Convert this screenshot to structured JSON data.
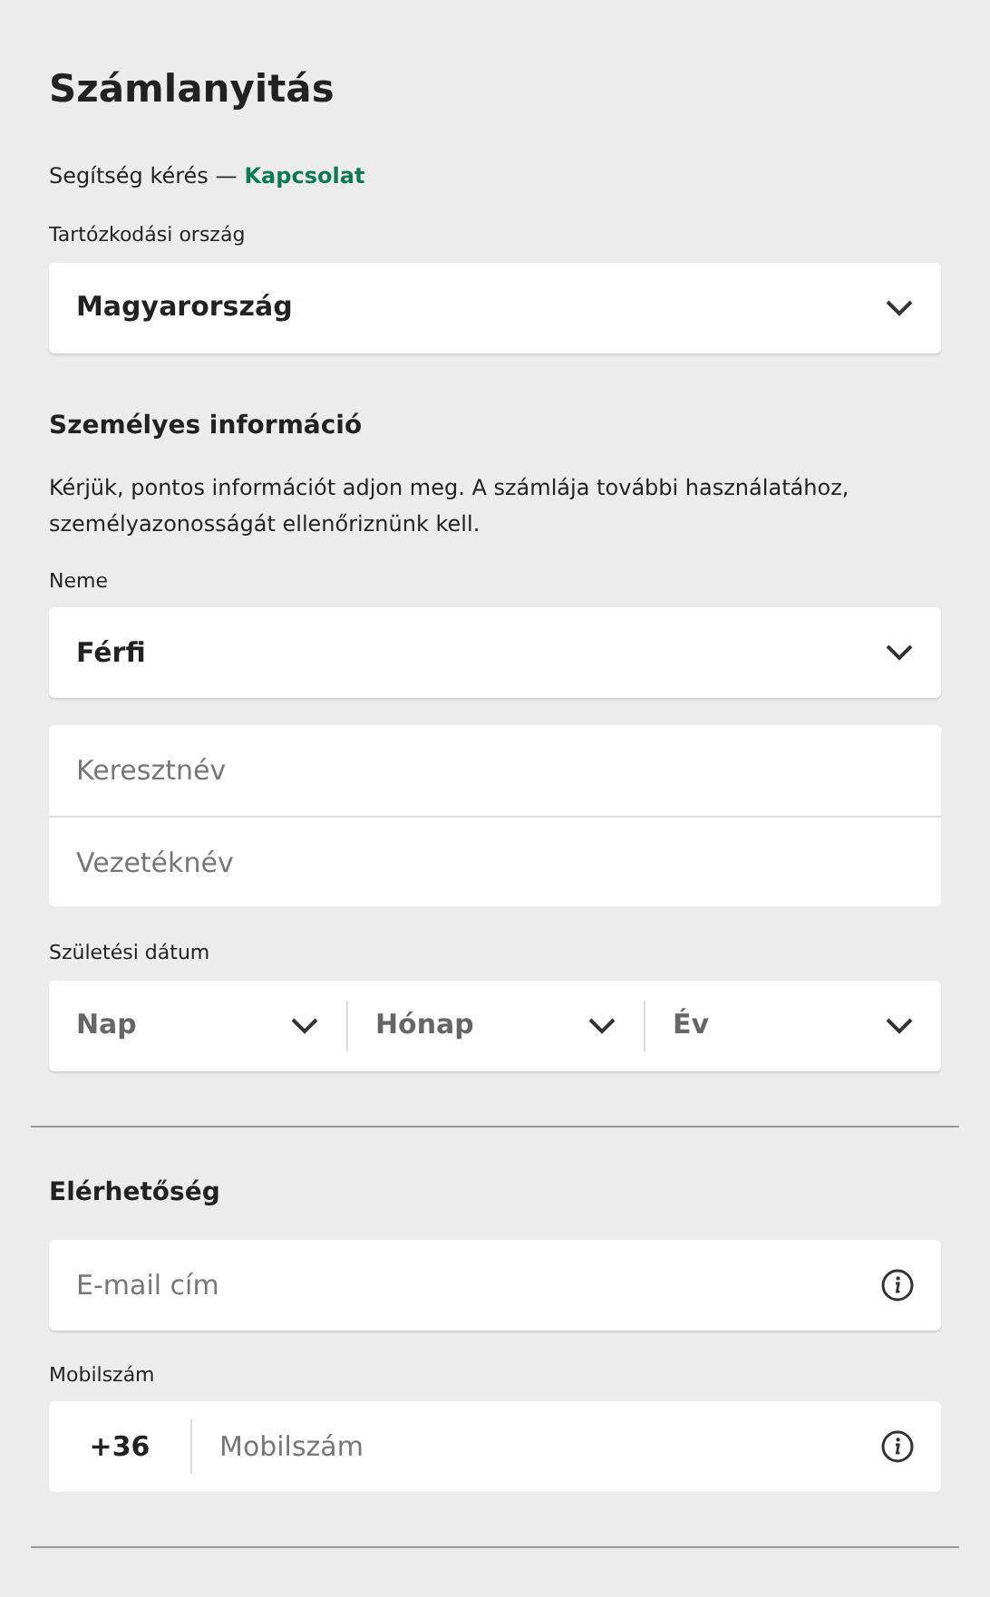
{
  "title": "Számlanyitás",
  "help": {
    "text": "Segítség kérés —",
    "link": "Kapcsolat"
  },
  "country": {
    "label": "Tartózkodási ország",
    "value": "Magyarország"
  },
  "personal": {
    "heading": "Személyes információ",
    "description": "Kérjük, pontos információt adjon meg. A számlája további használatához, személyazonosságát ellenőriznünk kell.",
    "gender": {
      "label": "Neme",
      "value": "Férfi"
    },
    "name_fields": [
      {
        "placeholder": "Keresztnév"
      },
      {
        "placeholder": "Vezetéknév"
      }
    ],
    "birth_date": {
      "label": "Születési dátum",
      "parts": [
        {
          "placeholder": "Nap"
        },
        {
          "placeholder": "Hónap"
        },
        {
          "placeholder": "Év"
        }
      ]
    }
  },
  "contact": {
    "heading": "Elérhetőség",
    "email": {
      "placeholder": "E-mail cím"
    },
    "mobile": {
      "label": "Mobilszám",
      "prefix": "+36",
      "placeholder": "Mobilszám"
    }
  }
}
